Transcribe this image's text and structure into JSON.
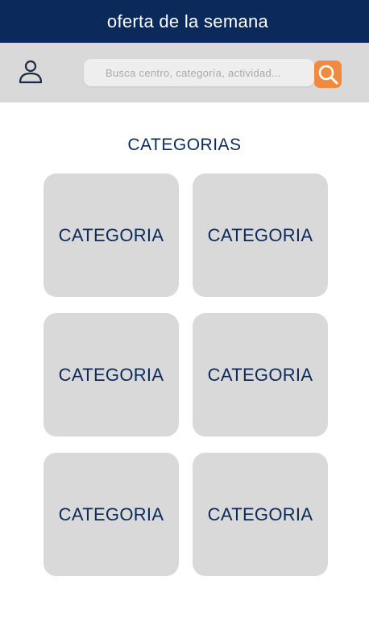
{
  "banner": {
    "text": "oferta de la semana",
    "background": "#0b2a5b"
  },
  "search": {
    "placeholder": "Busca centro, categoría, actividad...",
    "value": "",
    "button_color": "#f08a3e",
    "user_icon": "user-icon",
    "search_icon": "search-icon"
  },
  "main": {
    "title": "CATEGORIAS",
    "categories": [
      {
        "label": "CATEGORIA"
      },
      {
        "label": "CATEGORIA"
      },
      {
        "label": "CATEGORIA"
      },
      {
        "label": "CATEGORIA"
      },
      {
        "label": "CATEGORIA"
      },
      {
        "label": "CATEGORIA"
      }
    ],
    "card_color": "#d9d9d9",
    "text_color": "#0b2a5b"
  }
}
